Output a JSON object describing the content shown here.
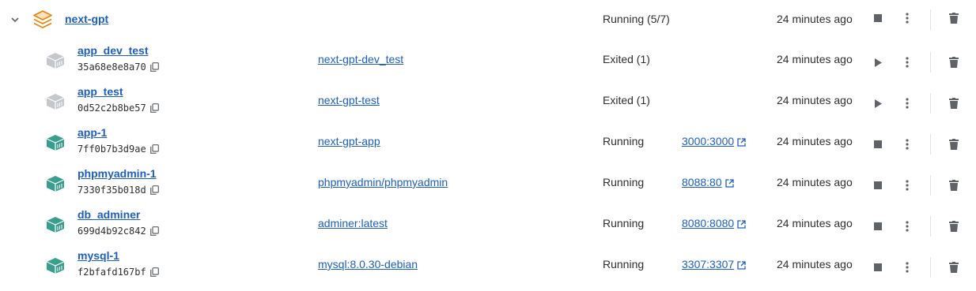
{
  "group": {
    "name": "next-gpt",
    "status": "Running (5/7)",
    "last_started": "24 minutes ago",
    "icon": "stack-icon",
    "accent_color": "#e8850c"
  },
  "containers": [
    {
      "name": "app_dev_test",
      "id": "35a68e8e8a70",
      "image": "next-gpt-dev_test",
      "status": "Exited (1)",
      "port": "",
      "last_started": "24 minutes ago",
      "running": false
    },
    {
      "name": "app_test",
      "id": "0d52c2b8be57",
      "image": "next-gpt-test",
      "status": "Exited (1)",
      "port": "",
      "last_started": "24 minutes ago",
      "running": false
    },
    {
      "name": "app-1",
      "id": "7ff0b7b3d9ae",
      "image": "next-gpt-app",
      "status": "Running",
      "port": "3000:3000",
      "last_started": "24 minutes ago",
      "running": true
    },
    {
      "name": "phpmyadmin-1",
      "id": "7330f35b018d",
      "image": "phpmyadmin/phpmyadmin",
      "status": "Running",
      "port": "8088:80",
      "last_started": "24 minutes ago",
      "running": true
    },
    {
      "name": "db_adminer",
      "id": "699d4b92c842",
      "image": "adminer:latest",
      "status": "Running",
      "port": "8080:8080",
      "last_started": "24 minutes ago",
      "running": true
    },
    {
      "name": "mysql-1",
      "id": "f2bfafd167bf",
      "image": "mysql:8.0.30-debian",
      "status": "Running",
      "port": "3307:3307",
      "last_started": "24 minutes ago",
      "running": true
    }
  ],
  "colors": {
    "link": "#1d5fbf",
    "running_icon": "#3a9e8f",
    "stopped_icon": "#c4c7cc",
    "action_icon": "#5f6368"
  }
}
